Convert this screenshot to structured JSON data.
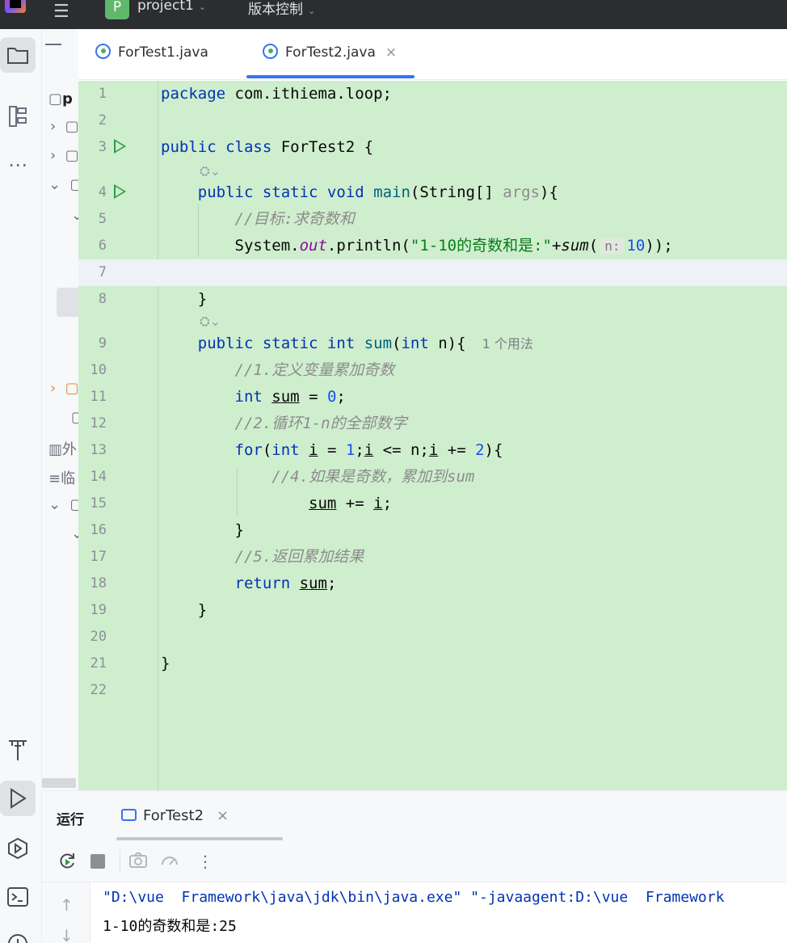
{
  "titlebar": {
    "project_badge": "P",
    "project_name": "project1",
    "vcs_label": "版本控制",
    "chevron": "⌄"
  },
  "sidebar_icons": [
    "folder-icon",
    "structure-icon",
    "more-icon",
    "build-icon",
    "run-icon",
    "services-icon",
    "terminal-icon",
    "problems-icon"
  ],
  "project_tree": {
    "root_label": "p",
    "external_label": "外",
    "scratch_label": "临"
  },
  "tabs": [
    {
      "label": "ForTest1.java"
    },
    {
      "label": "ForTest2.java",
      "close": "×"
    }
  ],
  "editor": {
    "line_numbers": [
      "1",
      "2",
      "3",
      "4",
      "5",
      "6",
      "7",
      "8",
      "9",
      "10",
      "11",
      "12",
      "13",
      "14",
      "15",
      "16",
      "17",
      "18",
      "19",
      "20",
      "21",
      "22"
    ],
    "inlay_hint": "n:",
    "usages": "1 个用法"
  },
  "bottom": {
    "run_label": "运行",
    "run_tab": "ForTest2",
    "close": "×"
  },
  "console": {
    "command": "\"D:\\vue  Framework\\java\\jdk\\bin\\java.exe\" \"-javaagent:D:\\vue  Framework",
    "output": "1-10的奇数和是:25"
  },
  "colors": {
    "keyword": "#0033b3",
    "string": "#067d17",
    "comment": "#8c8c8c",
    "number": "#1750eb",
    "editor_bg": "#cfeece",
    "accent": "#3574f0"
  }
}
